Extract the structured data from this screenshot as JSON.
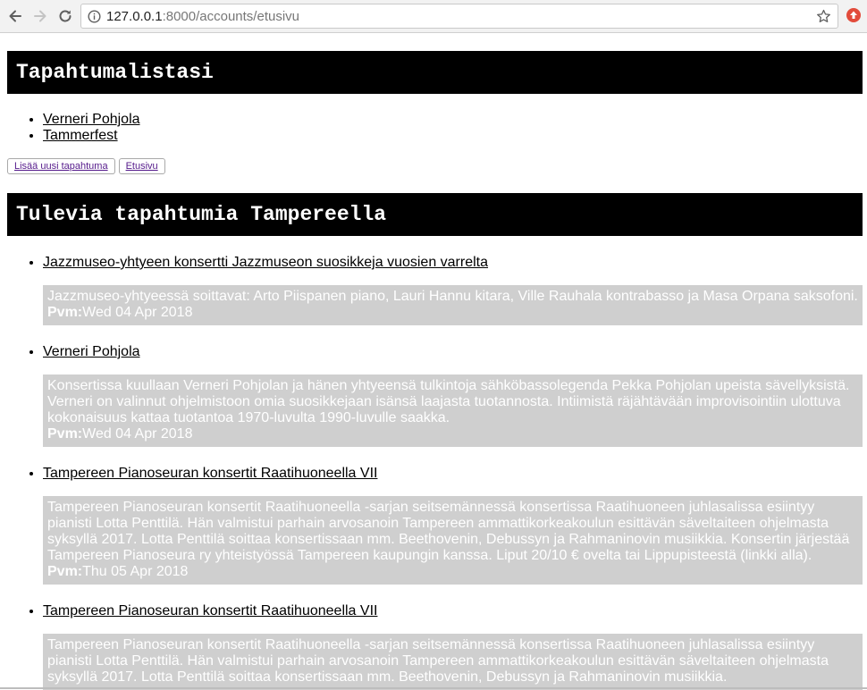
{
  "browser": {
    "url_host": "127.0.0.1",
    "url_rest": ":8000/accounts/etusivu"
  },
  "my_events": {
    "title": "Tapahtumalistasi",
    "items": [
      {
        "label": "Verneri Pohjola"
      },
      {
        "label": "Tammerfest"
      }
    ],
    "add_button": "Lisää uusi tapahtuma",
    "home_button": "Etusivu"
  },
  "upcoming": {
    "title": "Tulevia tapahtumia Tampereella",
    "date_label": "Pvm:",
    "events": [
      {
        "title": "Jazzmuseo-yhtyeen konsertti Jazzmuseon suosikkeja vuosien varrelta",
        "description": "Jazzmuseo-yhtyeessä soittavat: Arto Piispanen piano, Lauri Hannu kitara, Ville Rauhala kontrabasso ja Masa Orpana saksofoni.",
        "date": "Wed 04 Apr 2018"
      },
      {
        "title": "Verneri Pohjola",
        "description": "Konsertissa kuullaan Verneri Pohjolan ja hänen yhtyeensä tulkintoja sähköbassolegenda Pekka Pohjolan upeista sävellyksistä. Verneri on valinnut ohjelmistoon omia suosikkejaan isänsä laajasta tuotannosta. Intiimistä räjähtävään improvisointiin ulottuva kokonaisuus kattaa tuotantoa 1970-luvulta 1990-luvulle saakka.",
        "date": "Wed 04 Apr 2018"
      },
      {
        "title": "Tampereen Pianoseuran konsertit Raatihuoneella VII",
        "description": "Tampereen Pianoseuran konsertit Raatihuoneella -sarjan seitsemännessä konsertissa Raatihuoneen juhlasalissa esiintyy pianisti Lotta Penttilä. Hän valmistui parhain arvosanoin Tampereen ammattikorkeakoulun esittävän säveltaiteen ohjelmasta syksyllä 2017. Lotta Penttilä soittaa konsertissaan mm. Beethovenin, Debussyn ja Rahmaninovin musiikkia. Konsertin järjestää Tampereen Pianoseura ry yhteistyössä Tampereen kaupungin kanssa. Liput 20/10 € ovelta tai Lippupisteestä (linkki alla).",
        "date": "Thu 05 Apr 2018"
      },
      {
        "title": "Tampereen Pianoseuran konsertit Raatihuoneella VII",
        "description": "Tampereen Pianoseuran konsertit Raatihuoneella -sarjan seitsemännessä konsertissa Raatihuoneen juhlasalissa esiintyy pianisti Lotta Penttilä. Hän valmistui parhain arvosanoin Tampereen ammattikorkeakoulun esittävän säveltaiteen ohjelmasta syksyllä 2017. Lotta Penttilä soittaa konsertissaan mm. Beethovenin, Debussyn ja Rahmaninovin musiikkia.",
        "date": ""
      }
    ]
  }
}
